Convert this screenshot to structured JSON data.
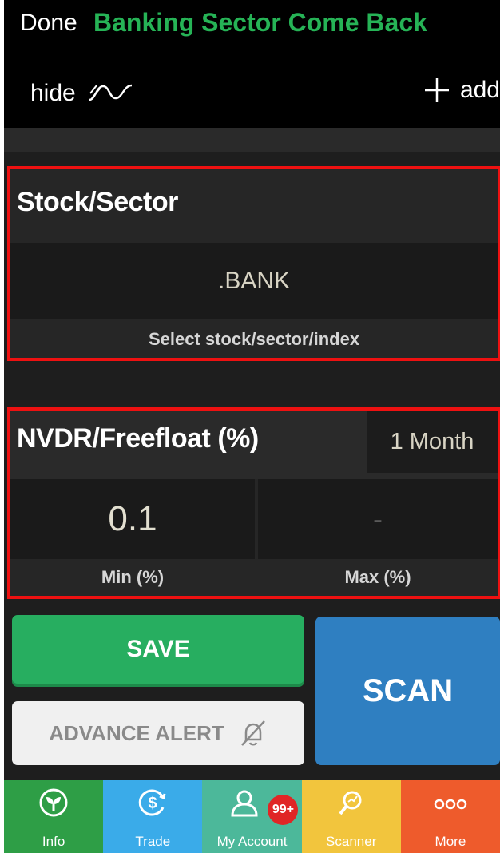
{
  "header": {
    "done_label": "Done",
    "title": "Banking Sector Come Back",
    "hide_label": "hide",
    "add_label": "add"
  },
  "stock_panel": {
    "title": "Stock/Sector",
    "value": ".BANK",
    "hint": "Select stock/sector/index"
  },
  "nvdr_panel": {
    "title": "NVDR/Freefloat (%)",
    "period": "1 Month",
    "min_value": "0.1",
    "max_value": "-",
    "min_label": "Min (%)",
    "max_label": "Max (%)"
  },
  "actions": {
    "save_label": "SAVE",
    "advance_alert_label": "ADVANCE ALERT",
    "scan_label": "SCAN"
  },
  "tabs": [
    {
      "label": "Info",
      "icon": "leaf-icon",
      "color": "#2e9e46"
    },
    {
      "label": "Trade",
      "icon": "dollar-icon",
      "color": "#3aabe9"
    },
    {
      "label": "My Account",
      "icon": "user-icon",
      "color": "#4cb89a",
      "badge": "99+"
    },
    {
      "label": "Scanner",
      "icon": "magnifier-icon",
      "color": "#f2c53d"
    },
    {
      "label": "More",
      "icon": "more-dots-icon",
      "color": "#ee5b2c"
    }
  ],
  "colors": {
    "title_green": "#26b356",
    "highlight_border": "#ee1111",
    "save_green": "#27ae60",
    "scan_blue": "#2f7fc1"
  }
}
